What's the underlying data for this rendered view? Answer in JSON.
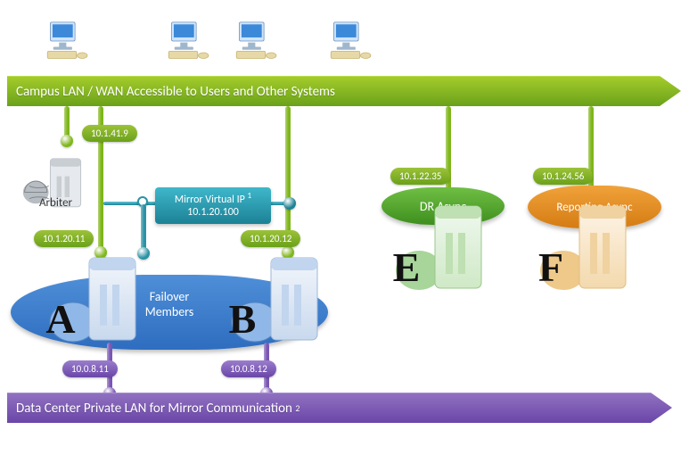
{
  "networks": {
    "campus_label": "Campus LAN / WAN Accessible to Users and Other Systems",
    "private_label": "Data Center Private LAN for Mirror Communication",
    "private_note_sup": "2"
  },
  "arbiter": {
    "label": "Arbiter",
    "campus_ip": "10.1.41.9"
  },
  "failover": {
    "group_label": "Failover Members",
    "members": [
      {
        "id": "A",
        "letter": "A",
        "campus_ip": "10.1.20.11",
        "private_ip": "10.0.8.11"
      },
      {
        "id": "B",
        "letter": "B",
        "campus_ip": "10.1.20.12",
        "private_ip": "10.0.8.12"
      }
    ],
    "virtual_ip": {
      "title": "Mirror Virtual IP",
      "title_sup": "1",
      "ip": "10.1.20.100"
    }
  },
  "asyncs": [
    {
      "id": "E",
      "letter": "E",
      "role": "DR Async",
      "campus_ip": "10.1.22.35",
      "color": "green"
    },
    {
      "id": "F",
      "letter": "F",
      "role": "Reporting Async",
      "campus_ip": "10.1.24.56",
      "color": "orange"
    }
  ],
  "workstations_count": 4
}
